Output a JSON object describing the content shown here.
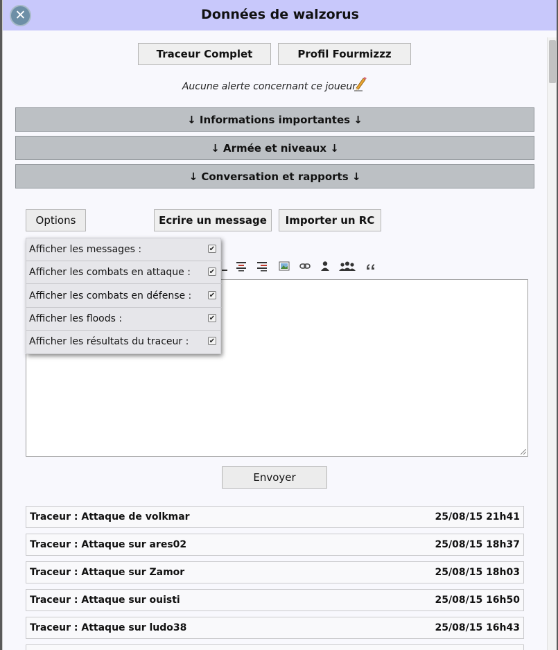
{
  "window": {
    "title": "Données de walzorus",
    "close_symbol": "✕"
  },
  "top_buttons": {
    "traceur": "Traceur Complet",
    "profil": "Profil Fourmizzz"
  },
  "alert": {
    "text": "Aucune alerte concernant ce joueur",
    "edit_icon": "pencil-icon"
  },
  "sections": [
    {
      "label": "↓ Informations importantes ↓"
    },
    {
      "label": "↓ Armée et niveaux ↓"
    },
    {
      "label": "↓ Conversation et rapports ↓"
    }
  ],
  "actions": {
    "options": "Options",
    "write": "Ecrire un message",
    "import": "Importer un RC"
  },
  "options_menu": [
    {
      "label": "Afficher les messages :",
      "checked": true
    },
    {
      "label": "Afficher les combats en attaque :",
      "checked": true
    },
    {
      "label": "Afficher les combats en défense :",
      "checked": true
    },
    {
      "label": "Afficher les floods :",
      "checked": true
    },
    {
      "label": "Afficher les résultats du traceur :",
      "checked": true
    }
  ],
  "editor": {
    "check_mark": "✔",
    "send": "Envoyer"
  },
  "reports": [
    {
      "title": "Traceur : Attaque de volkmar",
      "date": "25/08/15 21h41"
    },
    {
      "title": "Traceur : Attaque sur ares02",
      "date": "25/08/15 18h37"
    },
    {
      "title": "Traceur : Attaque sur Zamor",
      "date": "25/08/15 18h03"
    },
    {
      "title": "Traceur : Attaque sur ouisti",
      "date": "25/08/15 16h50"
    },
    {
      "title": "Traceur : Attaque sur ludo38",
      "date": "25/08/15 16h43"
    }
  ]
}
